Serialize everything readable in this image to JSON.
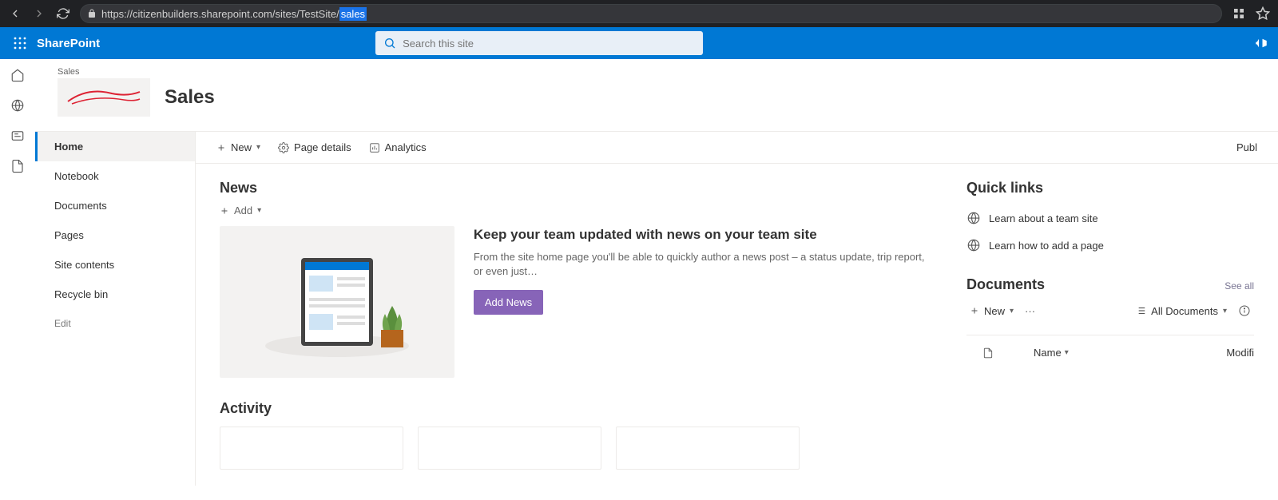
{
  "browser": {
    "url_prefix": "https://citizenbuilders.sharepoint.com/sites/TestSite/",
    "url_selected": "sales"
  },
  "header": {
    "app": "SharePoint",
    "search_placeholder": "Search this site"
  },
  "site": {
    "breadcrumb": "Sales",
    "title": "Sales"
  },
  "leftnav": {
    "items": [
      {
        "label": "Home",
        "active": true
      },
      {
        "label": "Notebook",
        "active": false
      },
      {
        "label": "Documents",
        "active": false
      },
      {
        "label": "Pages",
        "active": false
      },
      {
        "label": "Site contents",
        "active": false
      },
      {
        "label": "Recycle bin",
        "active": false
      }
    ],
    "edit": "Edit"
  },
  "cmd": {
    "new": "New",
    "page_details": "Page details",
    "analytics": "Analytics",
    "publish": "Publ"
  },
  "news": {
    "heading": "News",
    "add": "Add",
    "title": "Keep your team updated with news on your team site",
    "body": "From the site home page you'll be able to quickly author a news post – a status update, trip report, or even just…",
    "button": "Add News"
  },
  "activity": {
    "heading": "Activity"
  },
  "quicklinks": {
    "heading": "Quick links",
    "items": [
      "Learn about a team site",
      "Learn how to add a page"
    ]
  },
  "documents": {
    "heading": "Documents",
    "see_all": "See all",
    "new": "New",
    "view": "All Documents",
    "col_name": "Name",
    "col_modified": "Modifi"
  }
}
